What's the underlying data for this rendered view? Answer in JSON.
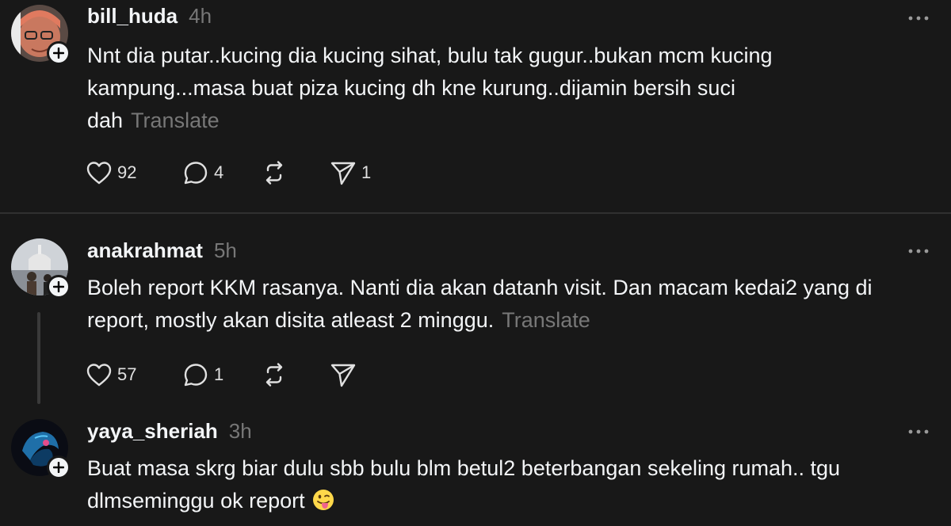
{
  "posts": [
    {
      "username": "bill_huda",
      "time": "4h",
      "text": "Nnt dia putar..kucing dia kucing sihat, bulu tak gugur..bukan mcm kucing kampung...masa buat piza kucing dh kne kurung..dijamin bersih suci dah",
      "translate": "Translate",
      "likes": "92",
      "replies": "4",
      "reposts": "",
      "shares": "1"
    },
    {
      "username": "anakrahmat",
      "time": "5h",
      "text": "Boleh report KKM rasanya. Nanti dia akan datanh visit. Dan macam kedai2 yang di report, mostly akan disita atleast 2 minggu.",
      "translate": "Translate",
      "likes": "57",
      "replies": "1",
      "reposts": "",
      "shares": ""
    },
    {
      "username": "yaya_sheriah",
      "time": "3h",
      "text": "Buat masa skrg biar dulu sbb bulu blm betul2 beterbangan sekeling rumah.. tgu dlmseminggu ok report",
      "emoji": "😛"
    }
  ],
  "icons": {
    "like": "heart-icon",
    "reply": "comment-icon",
    "repost": "repost-icon",
    "share": "send-icon",
    "more": "more-icon",
    "follow": "plus-icon"
  },
  "colors": {
    "background": "#181818",
    "text": "#f3f5f7",
    "muted": "#777777",
    "divider": "#303030"
  }
}
